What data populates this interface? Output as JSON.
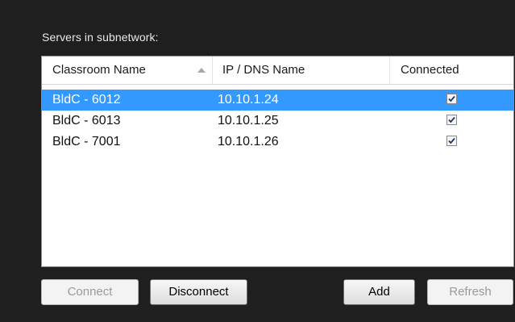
{
  "servers_label": "Servers in subnetwork:",
  "columns": {
    "classroom": "Classroom Name",
    "ip": "IP / DNS Name",
    "connected": "Connected"
  },
  "rows": [
    {
      "name": "BldC - 6012",
      "ip": "10.10.1.24",
      "connected": true,
      "selected": true
    },
    {
      "name": "BldC - 6013",
      "ip": "10.10.1.25",
      "connected": true,
      "selected": false
    },
    {
      "name": "BldC - 7001",
      "ip": "10.10.1.26",
      "connected": true,
      "selected": false
    }
  ],
  "buttons": {
    "connect": "Connect",
    "disconnect": "Disconnect",
    "add": "Add",
    "refresh": "Refresh"
  },
  "colors": {
    "selection": "#3399ff",
    "panel_background": "#1f1f1f"
  },
  "icons": {
    "sort": "sort-ascending-arrow-icon",
    "checkbox": "checkbox-checked-icon"
  }
}
